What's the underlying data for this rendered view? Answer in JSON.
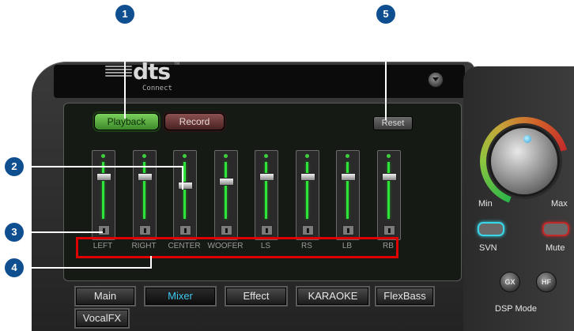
{
  "logo": {
    "brand": "dts",
    "sub": "Connect",
    "tm": "TM"
  },
  "controls": {
    "playback": "Playback",
    "record": "Record",
    "reset": "Reset"
  },
  "channels": [
    {
      "label": "LEFT",
      "level": 0.8
    },
    {
      "label": "RIGHT",
      "level": 0.8
    },
    {
      "label": "CENTER",
      "level": 0.65
    },
    {
      "label": "WOOFER",
      "level": 0.72
    },
    {
      "label": "LS",
      "level": 0.8
    },
    {
      "label": "RS",
      "level": 0.8
    },
    {
      "label": "LB",
      "level": 0.8
    },
    {
      "label": "RB",
      "level": 0.8
    }
  ],
  "tabs": [
    "Main",
    "Mixer",
    "Effect",
    "KARAOKE",
    "FlexBass",
    "VocalFX"
  ],
  "active_tab": "Mixer",
  "volume": {
    "min_label": "Min",
    "max_label": "Max"
  },
  "right_buttons": {
    "svn": "SVN",
    "mute": "Mute",
    "gx": "GX",
    "hf": "HF",
    "dsp_mode": "DSP Mode"
  },
  "callouts": [
    "1",
    "2",
    "3",
    "4",
    "5"
  ],
  "colors": {
    "accent_green": "#2ee33a",
    "active_tab": "#3fc7ee",
    "callout_blue": "#0f4f8f",
    "highlight_red": "#e10000"
  }
}
